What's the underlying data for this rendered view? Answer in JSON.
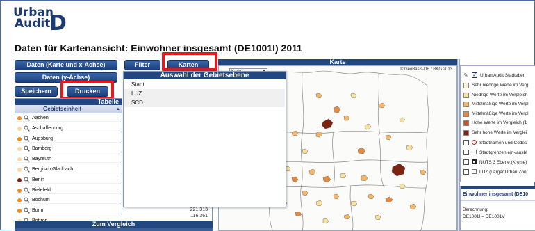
{
  "logo": {
    "word1": "Urban",
    "word2": "Audit",
    "letter": "D"
  },
  "page_title": "Daten für Kartenansicht: Einwohner insgesamt (DE1001I) 2011",
  "buttons": {
    "daten_karte": "Daten (Karte und x-Achse)",
    "daten_y": "Daten (y-Achse)",
    "speichern": "Speichern",
    "drucken": "Drucken",
    "filter": "Filter",
    "karten": "Karten"
  },
  "table": {
    "bar_title": "Tabelle",
    "column_header": "Gebietseinheit",
    "rows": [
      {
        "name": "Aachen",
        "dot": "#f08c1e"
      },
      {
        "name": "Aschaffenburg",
        "dot": "#f8d9a0"
      },
      {
        "name": "Augsburg",
        "dot": "#f08c1e"
      },
      {
        "name": "Bamberg",
        "dot": "#f8d9a0"
      },
      {
        "name": "Bayreuth",
        "dot": "#f8d9a0"
      },
      {
        "name": "Bergisch Gladbach",
        "dot": "#f8d9a0"
      },
      {
        "name": "Berlin",
        "dot": "#7a2414"
      },
      {
        "name": "Bielefeld",
        "dot": "#f08c1e"
      },
      {
        "name": "Bochum",
        "dot": "#f08c1e"
      },
      {
        "name": "Bonn",
        "dot": "#f08c1e"
      },
      {
        "name": "Bottrop",
        "dot": "#f8d9a0"
      }
    ],
    "values": [
      "116.361"
    ],
    "partial_value": "221.313"
  },
  "compare_bar": "Zum Vergleich",
  "dropdown": {
    "title": "Auswahl der Gebietsebene",
    "items": [
      "Stadt",
      "LUZ",
      "SCD"
    ]
  },
  "map": {
    "bar_title": "Karte",
    "copyright": "© GeoBasis-DE / BKG 2013",
    "combo_value": "Karte"
  },
  "legend": {
    "header": "Urban Audit Stadteben",
    "classes": [
      {
        "label": "Sehr niedrige Werte im Verg",
        "color": "#fbf5d6"
      },
      {
        "label": "Niedrige Werte im Vergleich",
        "color": "#f8e2a0"
      },
      {
        "label": "Mittelmäßige Werte im Vergl",
        "color": "#f3b86a"
      },
      {
        "label": "Mittelmäßige Werte im Vergl",
        "color": "#e48b43"
      },
      {
        "label": "Hohe Werte im Vergleich (1",
        "color": "#c2542b"
      },
      {
        "label": "Sehr hohe Werte im Verglei",
        "color": "#7a2414"
      }
    ],
    "layers": [
      {
        "label": "Stadtnamen und Codes"
      },
      {
        "label": "Stadtgrenzen ein-/ausbl"
      },
      {
        "label": "NUTS 3 Ebene (Kreise)"
      },
      {
        "label": "LUZ (Larger Urban Zon"
      }
    ]
  },
  "info": {
    "title": "Einwohner insgesamt (DE10",
    "berechnung_label": "Berechnung:",
    "berechnung_value": "DE1001I = DE1001V"
  },
  "colors": {
    "accent": "#22467f",
    "highlight": "#e5191d"
  }
}
